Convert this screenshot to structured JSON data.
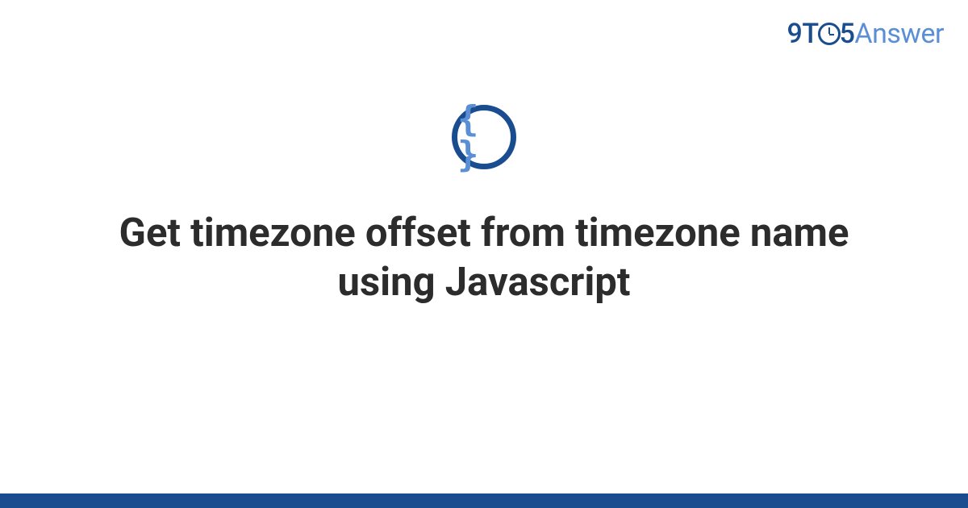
{
  "logo": {
    "part1": "9T",
    "part2": "5",
    "part3": "Answer"
  },
  "icon": {
    "name": "code-braces-icon",
    "glyph": "{ }"
  },
  "title": "Get timezone offset from timezone name using Javascript"
}
